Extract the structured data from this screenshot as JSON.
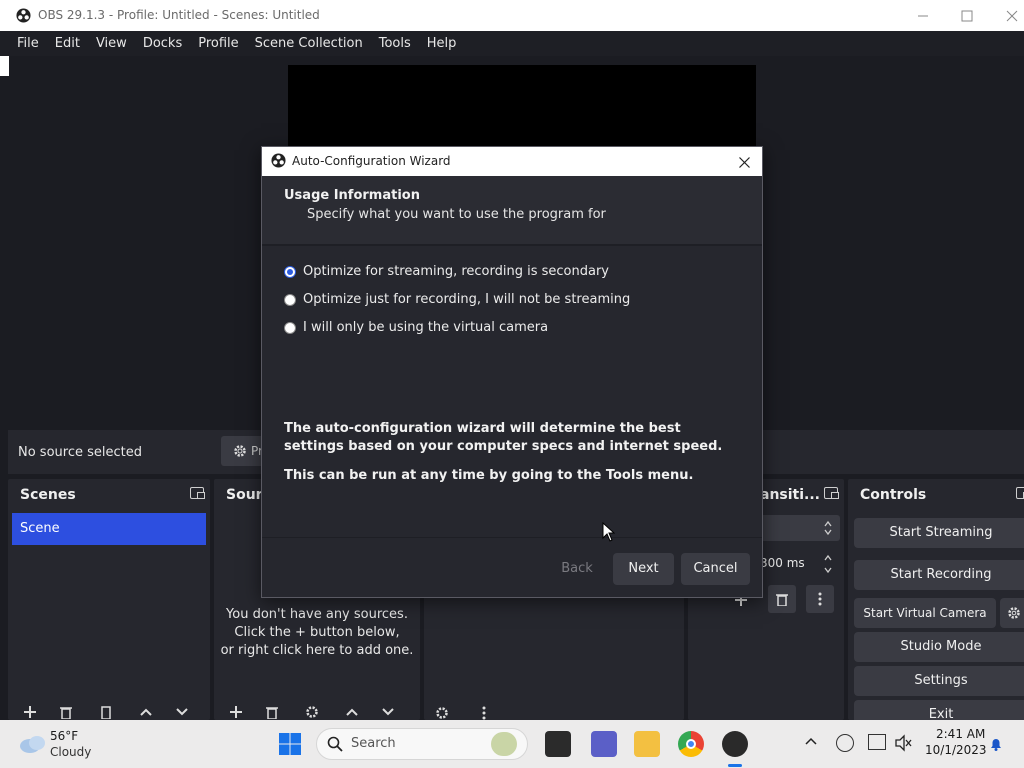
{
  "window": {
    "title": "OBS 29.1.3 - Profile: Untitled - Scenes: Untitled",
    "minimize_icon": "minimize-icon",
    "maximize_icon": "maximize-icon",
    "close_icon": "close-icon"
  },
  "menu": [
    "File",
    "Edit",
    "View",
    "Docks",
    "Profile",
    "Scene Collection",
    "Tools",
    "Help"
  ],
  "source_bar": {
    "no_source": "No source selected",
    "properties_label": "Pr"
  },
  "scenes": {
    "title": "Scenes",
    "items": [
      "Scene"
    ]
  },
  "sources": {
    "title": "Sourc",
    "empty_line1": "You don't have any sources.",
    "empty_line2": "Click the + button below,",
    "empty_line3": "or right click here to add one."
  },
  "transitions": {
    "title": "ansiti...",
    "duration": "300 ms"
  },
  "controls": {
    "title": "Controls",
    "start_streaming": "Start Streaming",
    "start_recording": "Start Recording",
    "start_virtual_camera": "Start Virtual Camera",
    "studio_mode": "Studio Mode",
    "settings": "Settings",
    "exit": "Exit"
  },
  "dialog": {
    "title": "Auto-Configuration Wizard",
    "heading": "Usage Information",
    "subheading": "Specify what you want to use the program for",
    "options": [
      {
        "label": "Optimize for streaming, recording is secondary",
        "selected": true
      },
      {
        "label": "Optimize just for recording, I will not be streaming",
        "selected": false
      },
      {
        "label": "I will only be using the virtual camera",
        "selected": false
      }
    ],
    "info1": "The auto-configuration wizard will determine the best settings based on your computer specs and internet speed.",
    "info2": "This can be run at any time by going to the Tools menu.",
    "back": "Back",
    "next": "Next",
    "cancel": "Cancel"
  },
  "taskbar": {
    "weather_temp": "56°F",
    "weather_desc": "Cloudy",
    "search_placeholder": "Search",
    "time": "2:41 AM",
    "date": "10/1/2023"
  },
  "colors": {
    "accent": "#2d4fe0",
    "panel": "#26272e",
    "background": "#1b1c22"
  }
}
